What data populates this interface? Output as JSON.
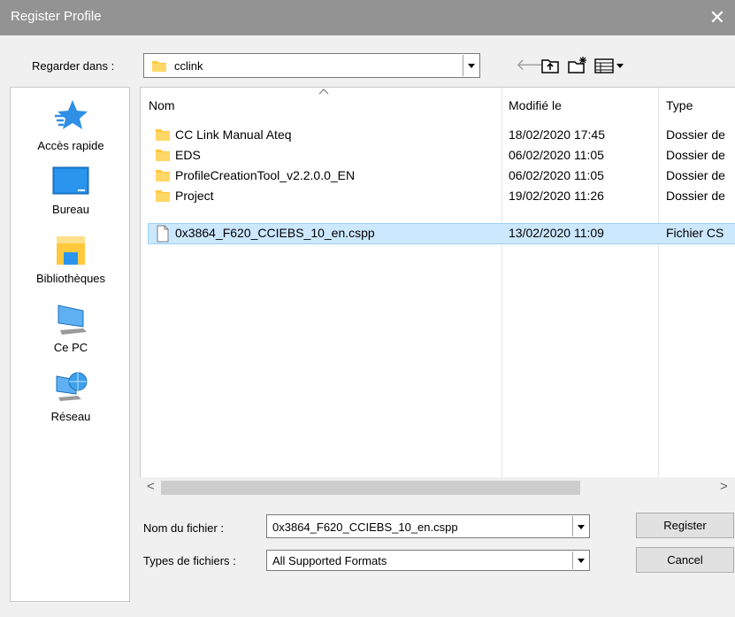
{
  "window": {
    "title": "Register Profile",
    "close_glyph": "✕"
  },
  "lookin": {
    "label": "Regarder dans :",
    "value": "cclink"
  },
  "toolbar": {
    "back_glyph": "🡐"
  },
  "places": [
    {
      "label": "Accès rapide",
      "icon": "star-icon"
    },
    {
      "label": "Bureau",
      "icon": "desktop-icon"
    },
    {
      "label": "Bibliothèques",
      "icon": "libraries-icon"
    },
    {
      "label": "Ce PC",
      "icon": "computer-icon"
    },
    {
      "label": "Réseau",
      "icon": "network-icon"
    }
  ],
  "filelist": {
    "columns": {
      "name": "Nom",
      "modified": "Modifié le",
      "type": "Type"
    },
    "rows": [
      {
        "name": "CC Link Manual Ateq",
        "date": "18/02/2020 17:45",
        "type": "Dossier de",
        "kind": "folder"
      },
      {
        "name": "EDS",
        "date": "06/02/2020 11:05",
        "type": "Dossier de",
        "kind": "folder"
      },
      {
        "name": "ProfileCreationTool_v2.2.0.0_EN",
        "date": "06/02/2020 11:05",
        "type": "Dossier de",
        "kind": "folder"
      },
      {
        "name": "Project",
        "date": "19/02/2020 11:26",
        "type": "Dossier de",
        "kind": "folder"
      },
      {
        "name": "0x3864_F620_CCIEBS_10_en.cspp",
        "date": "13/02/2020 11:09",
        "type": "Fichier CS",
        "kind": "file"
      }
    ]
  },
  "scroll": {
    "left_glyph": "<",
    "right_glyph": ">"
  },
  "filename": {
    "label": "Nom du fichier :",
    "value": "0x3864_F620_CCIEBS_10_en.cspp"
  },
  "filetype": {
    "label": "Types de fichiers :",
    "value": "All Supported Formats"
  },
  "buttons": {
    "register": "Register",
    "cancel": "Cancel"
  },
  "colors": {
    "titlebar": "#939393",
    "selection": "#cce8ff",
    "selection_border": "#99d1ff",
    "folder": "#ffc83d",
    "accent": "#0078d7"
  }
}
